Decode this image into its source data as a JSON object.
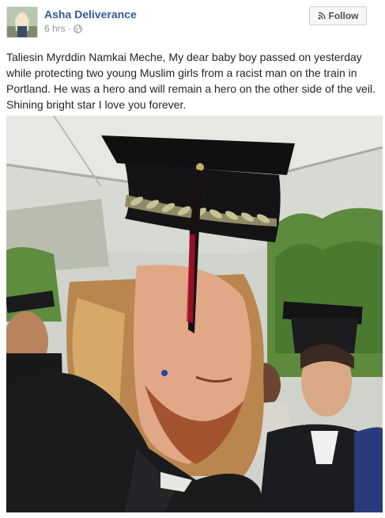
{
  "post": {
    "author": "Asha Deliverance",
    "time": "6 hrs",
    "separator": "·",
    "audience_icon": "globe-icon",
    "follow_label": "Follow",
    "follow_icon": "rss-icon",
    "text": "Taliesin Myrddin Namkai Meche, My dear baby boy passed on yesterday while protecting two young Muslim girls from a racist man on the train in Portland. He was a hero and will remain a hero on the other side of the veil. Shining bright star I love you forever.",
    "photo_subject": "graduation-photo"
  },
  "colors": {
    "link": "#365899",
    "meta": "#90949c",
    "text": "#1d2129",
    "button_border": "#ced0d4"
  }
}
